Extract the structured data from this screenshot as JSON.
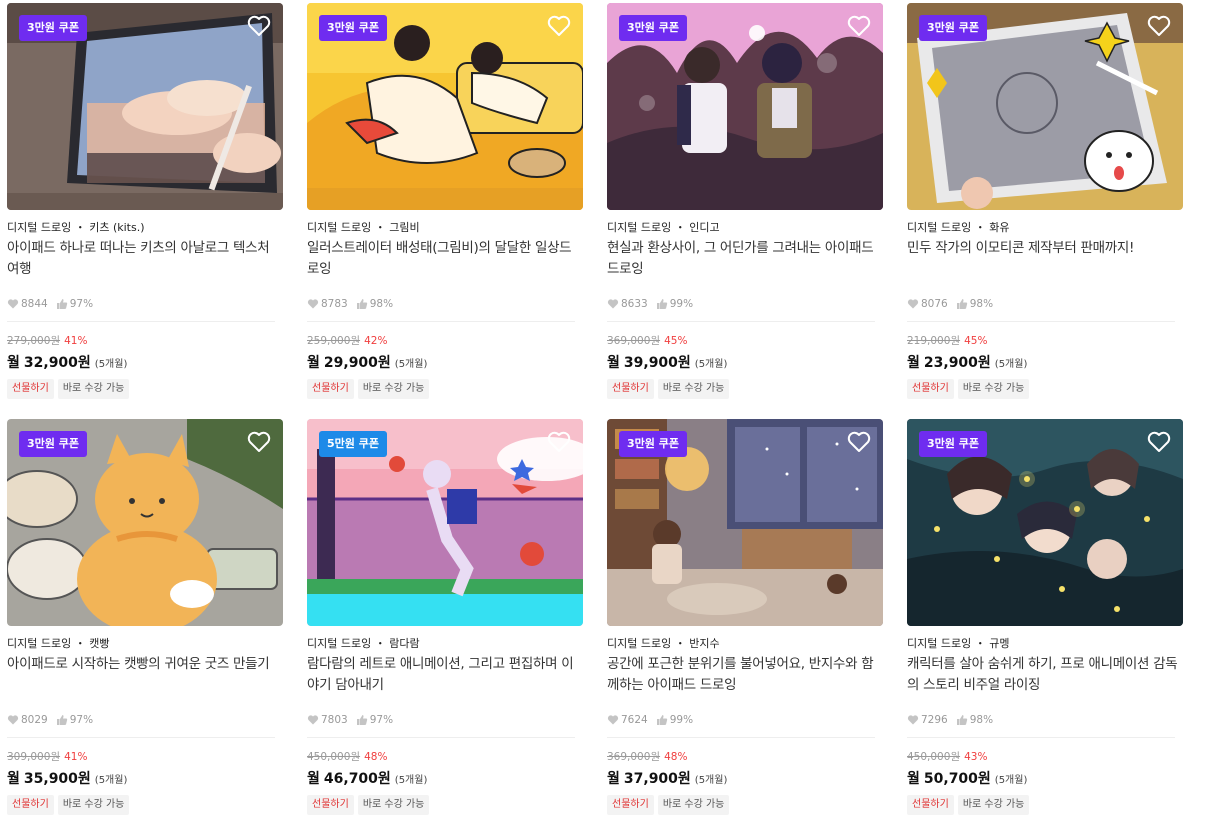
{
  "colors": {
    "coupon_purple": "#6f2cf0",
    "coupon_blue": "#1d8ae8",
    "discount_red": "#f03e3e"
  },
  "icons": {
    "wishlist": "heart-outline-icon",
    "likes": "heart-filled-icon",
    "rating": "thumbs-up-icon"
  },
  "courses": [
    {
      "coupon": "3만원 쿠폰",
      "coupon_color": "#6f2cf0",
      "category": "디지털 드로잉 ・ 키츠 (kits.)",
      "title": "아이패드 하나로 떠나는 키츠의 아날로그 텍스처 여행",
      "likes": "8844",
      "rating": "97%",
      "original_price": "279,000원",
      "discount": "41%",
      "monthly_label": "월",
      "monthly_price": "32,900원",
      "installment": "(5개월)",
      "gift_tag": "선물하기",
      "instant_tag": "바로 수강 가능"
    },
    {
      "coupon": "3만원 쿠폰",
      "coupon_color": "#6f2cf0",
      "category": "디지털 드로잉 ・ 그림비",
      "title": "일러스트레이터 배성태(그림비)의 달달한 일상드로잉",
      "likes": "8783",
      "rating": "98%",
      "original_price": "259,000원",
      "discount": "42%",
      "monthly_label": "월",
      "monthly_price": "29,900원",
      "installment": "(5개월)",
      "gift_tag": "선물하기",
      "instant_tag": "바로 수강 가능"
    },
    {
      "coupon": "3만원 쿠폰",
      "coupon_color": "#6f2cf0",
      "category": "디지털 드로잉 ・ 인디고",
      "title": "현실과 환상사이, 그 어딘가를 그려내는 아이패드 드로잉",
      "likes": "8633",
      "rating": "99%",
      "original_price": "369,000원",
      "discount": "45%",
      "monthly_label": "월",
      "monthly_price": "39,900원",
      "installment": "(5개월)",
      "gift_tag": "선물하기",
      "instant_tag": "바로 수강 가능"
    },
    {
      "coupon": "3만원 쿠폰",
      "coupon_color": "#6f2cf0",
      "category": "디지털 드로잉 ・ 화유",
      "title": "민두 작가의 이모티콘 제작부터 판매까지!",
      "likes": "8076",
      "rating": "98%",
      "original_price": "219,000원",
      "discount": "45%",
      "monthly_label": "월",
      "monthly_price": "23,900원",
      "installment": "(5개월)",
      "gift_tag": "선물하기",
      "instant_tag": "바로 수강 가능"
    },
    {
      "coupon": "3만원 쿠폰",
      "coupon_color": "#6f2cf0",
      "category": "디지털 드로잉 ・ 캣빵",
      "title": "아이패드로 시작하는 캣빵의 귀여운 굿즈 만들기",
      "likes": "8029",
      "rating": "97%",
      "original_price": "309,000원",
      "discount": "41%",
      "monthly_label": "월",
      "monthly_price": "35,900원",
      "installment": "(5개월)",
      "gift_tag": "선물하기",
      "instant_tag": "바로 수강 가능"
    },
    {
      "coupon": "5만원 쿠폰",
      "coupon_color": "#1d8ae8",
      "category": "디지털 드로잉 ・ 람다람",
      "title": "람다람의 레트로 애니메이션, 그리고 편집하며 이야기 담아내기",
      "likes": "7803",
      "rating": "97%",
      "original_price": "450,000원",
      "discount": "48%",
      "monthly_label": "월",
      "monthly_price": "46,700원",
      "installment": "(5개월)",
      "gift_tag": "선물하기",
      "instant_tag": "바로 수강 가능"
    },
    {
      "coupon": "3만원 쿠폰",
      "coupon_color": "#6f2cf0",
      "category": "디지털 드로잉 ・ 반지수",
      "title": "공간에 포근한 분위기를 불어넣어요, 반지수와 함께하는 아이패드 드로잉",
      "likes": "7624",
      "rating": "99%",
      "original_price": "369,000원",
      "discount": "48%",
      "monthly_label": "월",
      "monthly_price": "37,900원",
      "installment": "(5개월)",
      "gift_tag": "선물하기",
      "instant_tag": "바로 수강 가능"
    },
    {
      "coupon": "3만원 쿠폰",
      "coupon_color": "#6f2cf0",
      "category": "디지털 드로잉 ・ 규멩",
      "title": "캐릭터를 살아 숨쉬게 하기, 프로 애니메이션 감독의 스토리 비주얼 라이징",
      "likes": "7296",
      "rating": "98%",
      "original_price": "450,000원",
      "discount": "43%",
      "monthly_label": "월",
      "monthly_price": "50,700원",
      "installment": "(5개월)",
      "gift_tag": "선물하기",
      "instant_tag": "바로 수강 가능"
    }
  ]
}
